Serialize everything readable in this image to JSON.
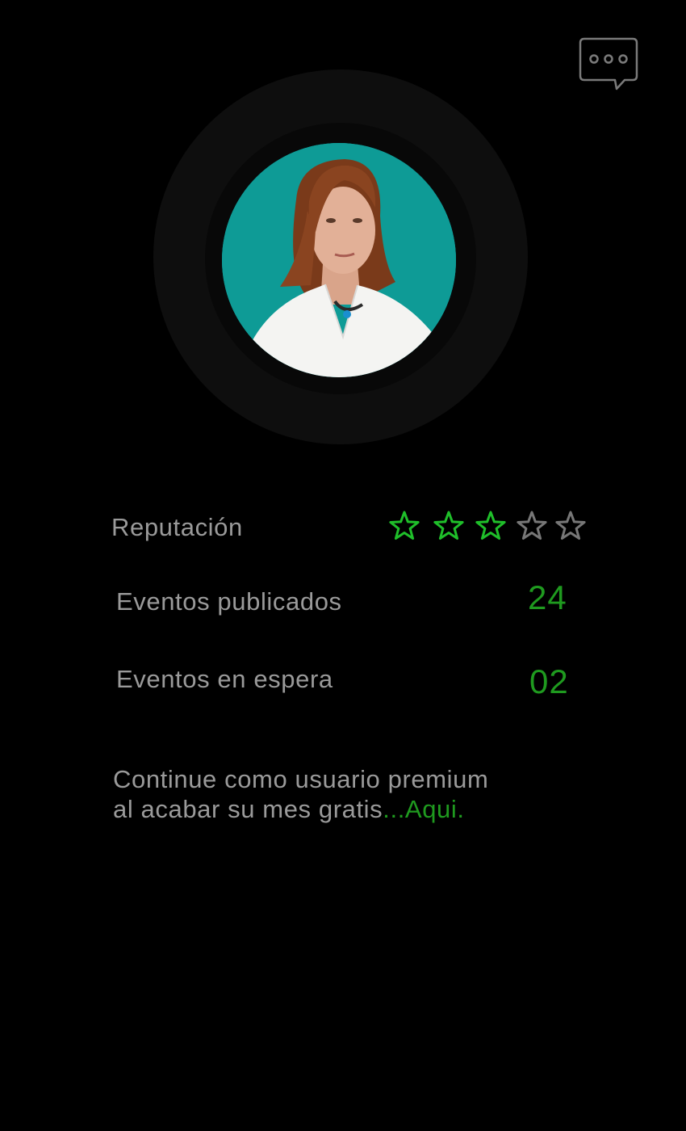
{
  "header": {
    "chat_icon": "chat-bubble-ellipsis-icon"
  },
  "profile": {
    "avatar_background": "#0e9b96"
  },
  "stats": {
    "reputation_label": "Reputación",
    "reputation_rating": 3,
    "reputation_max": 5,
    "published_label": "Eventos publicados",
    "published_value": "24",
    "pending_label": "Eventos en espera",
    "pending_value": "02"
  },
  "promo": {
    "line1": "Continue como usuario premium",
    "line2": "al acabar su mes gratis",
    "link": "...Aqui."
  },
  "colors": {
    "background": "#000000",
    "accent": "#1f9a1f",
    "star_filled": "#1fbf2a",
    "star_empty": "#777777",
    "text": "#9a9a9a"
  }
}
